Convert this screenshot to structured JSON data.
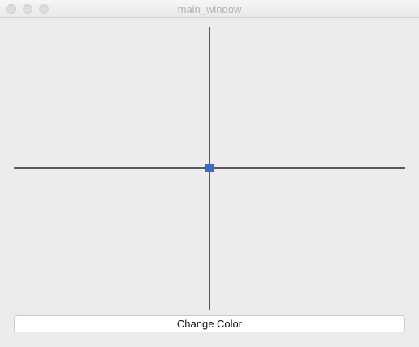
{
  "window": {
    "title": "main_window"
  },
  "canvas": {
    "point_color": "#3f66c4",
    "axis_color": "#5a5a5a"
  },
  "actions": {
    "change_color_label": "Change Color"
  }
}
